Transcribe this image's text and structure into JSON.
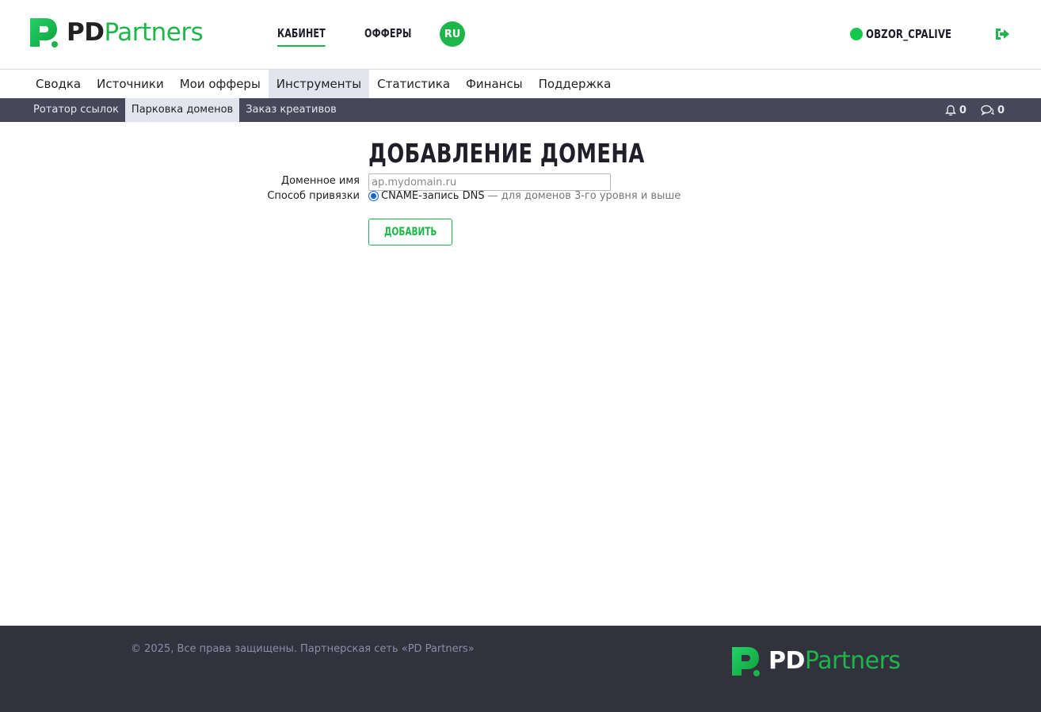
{
  "brand": {
    "part1": "PD",
    "part2": "Partners",
    "accent": "#1db64a"
  },
  "topnav": [
    {
      "label": "КАБИНЕТ",
      "active": true
    },
    {
      "label": "ОФФЕРЫ",
      "active": false
    }
  ],
  "lang": "RU",
  "user": {
    "name": "OBZOR_CPALIVE",
    "status_color": "#14c94a"
  },
  "mainnav": [
    "Сводка",
    "Источники",
    "Мои офферы",
    "Инструменты",
    "Статистика",
    "Финансы",
    "Поддержка"
  ],
  "mainnav_active": "Инструменты",
  "subnav": [
    "Ротатор ссылок",
    "Парковка доменов",
    "Заказ креативов"
  ],
  "subnav_active": "Парковка доменов",
  "counters": {
    "notifications": "0",
    "messages": "0"
  },
  "form": {
    "title": "ДОБАВЛЕНИЕ ДОМЕНА",
    "domain_label": "Доменное имя",
    "domain_placeholder": "ap.mydomain.ru",
    "binding_label": "Способ привязки",
    "binding_option": "CNAME-запись DNS",
    "binding_hint": "— для доменов 3-го уровня и выше",
    "submit": "ДОБАВИТЬ"
  },
  "footer": {
    "copyright": "© 2025, Все права защищены. Партнерская сеть «PD Partners»"
  }
}
